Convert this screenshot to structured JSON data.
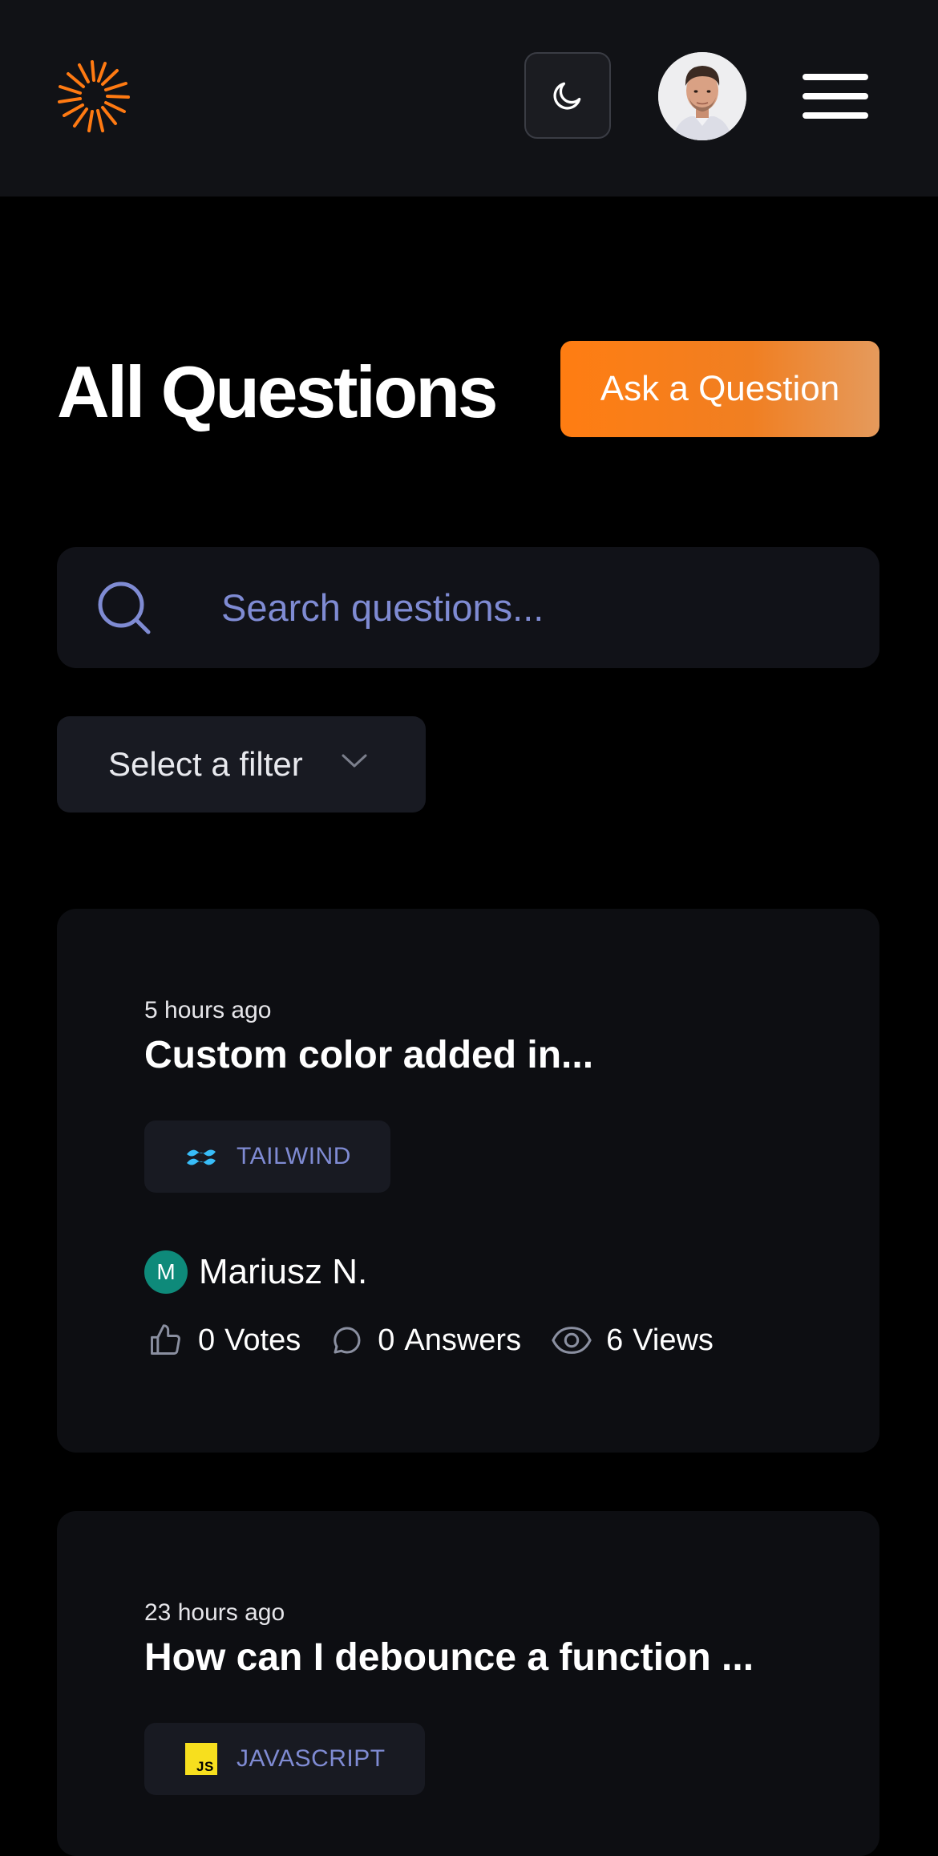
{
  "header": {
    "logo_icon": "sunburst-logo-icon",
    "theme_toggle_icon": "moon-icon",
    "avatar_alt": "user-avatar",
    "menu_icon": "hamburger-menu-icon"
  },
  "page": {
    "title": "All Questions",
    "ask_button_label": "Ask a Question"
  },
  "search": {
    "placeholder": "Search questions...",
    "icon": "search-icon"
  },
  "filter": {
    "selected_label": "Select a filter"
  },
  "questions": [
    {
      "time": "5 hours ago",
      "title": "Custom color added in...",
      "tag": "TAILWIND",
      "tag_icon": "tailwind-icon",
      "author_initial": "M",
      "author_name": "Mariusz N.",
      "votes": "0",
      "votes_label": "Votes",
      "answers": "0",
      "answers_label": "Answers",
      "views": "6",
      "views_label": "Views"
    },
    {
      "time": "23 hours ago",
      "title": "How can I debounce a function ...",
      "tag": "JAVASCRIPT",
      "tag_icon": "javascript-icon"
    }
  ],
  "colors": {
    "accent_orange": "#ff7d12",
    "tag_text": "#7f8bd3",
    "author_avatar": "#0e8a7a"
  }
}
